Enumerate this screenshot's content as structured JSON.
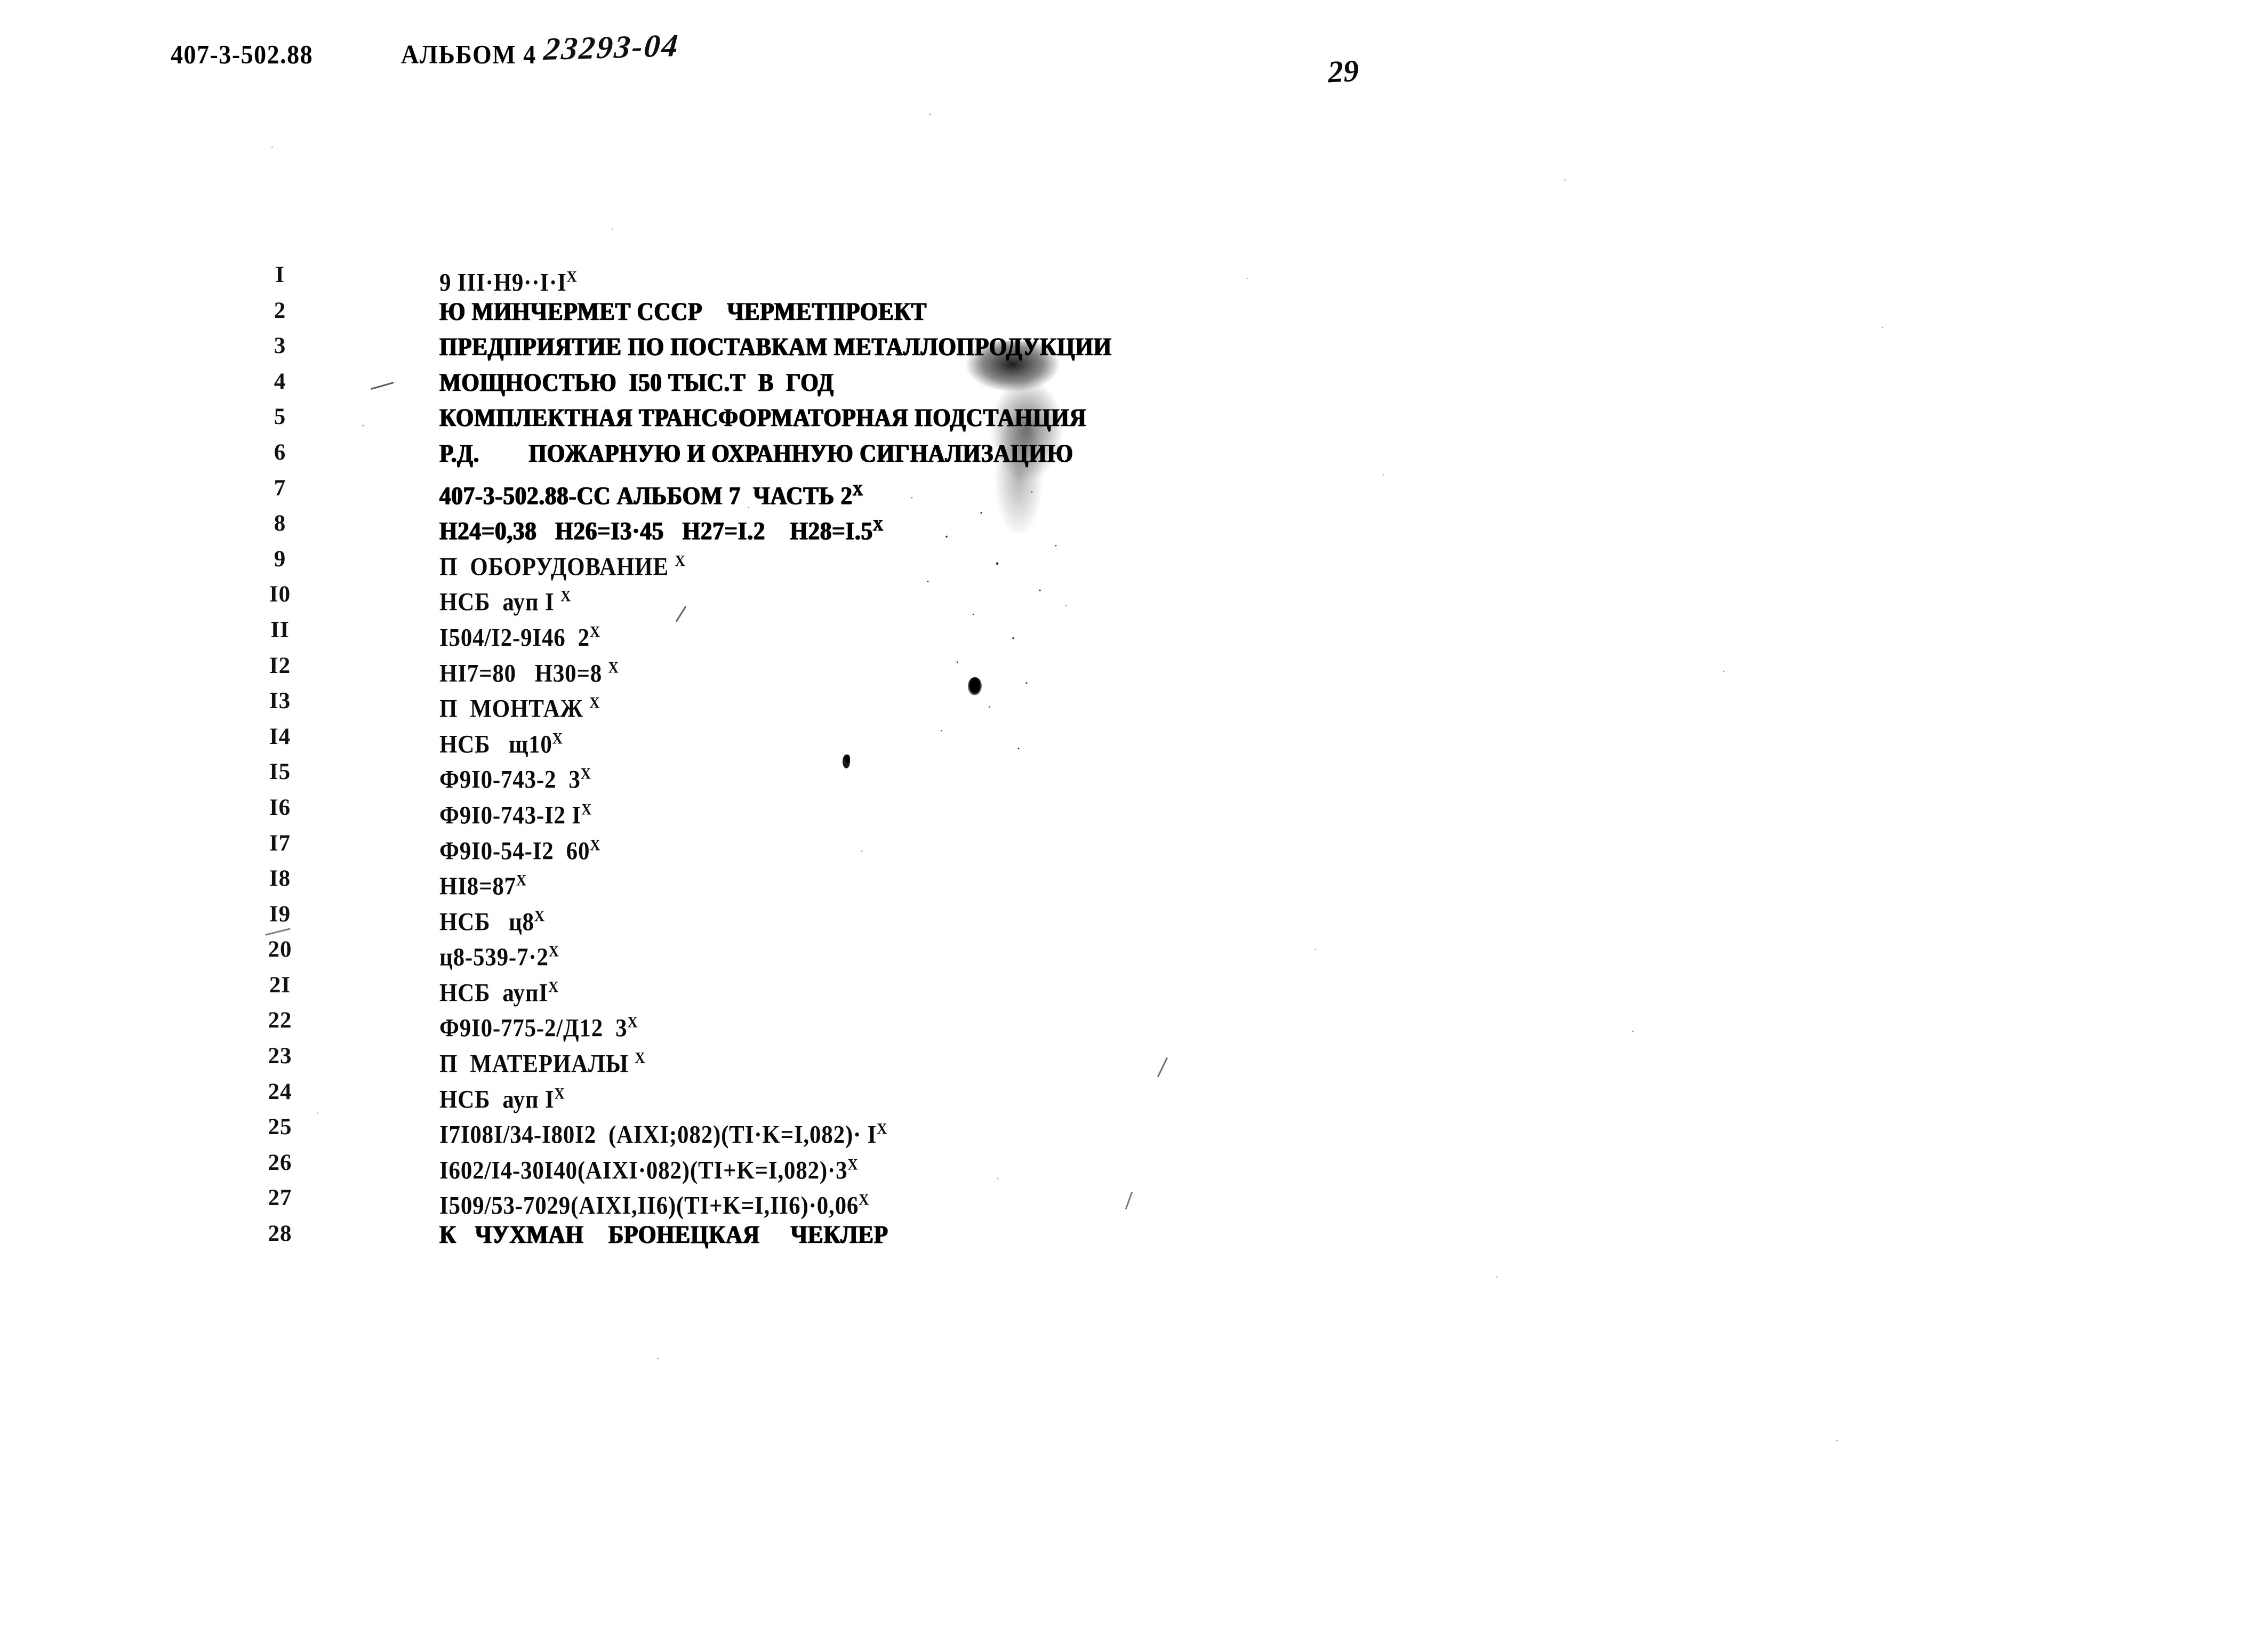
{
  "header": {
    "doc_code": "407-3-502.88",
    "album_label": "АЛЬБОМ 4",
    "order_number": "23293-04",
    "page_number": "29"
  },
  "listing": {
    "rows": [
      {
        "num": "I",
        "text": "9 III·H9··I·I",
        "sup": "X",
        "heavy": false
      },
      {
        "num": "2",
        "text": "Ю МИНЧЕРМЕТ СССР    ЧЕРМЕТПРОЕКТ",
        "sup": "",
        "heavy": true
      },
      {
        "num": "3",
        "text": "ПРЕДПРИЯТИЕ ПО ПОСТАВКАМ МЕТАЛЛОПРОДУКЦИИ",
        "sup": "",
        "heavy": true
      },
      {
        "num": "4",
        "text": "МОЩНОСТЬЮ  I50 ТЫС.Т  В  ГОД",
        "sup": "",
        "heavy": true
      },
      {
        "num": "5",
        "text": "КОМПЛЕКТНАЯ ТРАНСФОРМАТОРНАЯ ПОДСТАНЦИЯ",
        "sup": "",
        "heavy": true
      },
      {
        "num": "6",
        "text": "Р.Д.        ПОЖАРНУЮ И ОХРАННУЮ СИГНАЛИЗАЦИЮ",
        "sup": "",
        "heavy": true
      },
      {
        "num": "7",
        "text": "407-3-502.88-СС АЛЬБОМ 7  ЧАСТЬ 2",
        "sup": "X",
        "heavy": true
      },
      {
        "num": "8",
        "text": "H24=0,38   H26=I3·45   H27=I.2    H28=I.5",
        "sup": "X",
        "heavy": true
      },
      {
        "num": "9",
        "text": "П  ОБОРУДОВАНИЕ ",
        "sup": "X",
        "heavy": false
      },
      {
        "num": "I0",
        "text": "НСБ  ауп I ",
        "sup": "X",
        "heavy": false
      },
      {
        "num": "II",
        "text": "I504/I2-9I46  2",
        "sup": "X",
        "heavy": false
      },
      {
        "num": "I2",
        "text": "HI7=80   H30=8 ",
        "sup": "X",
        "heavy": false
      },
      {
        "num": "I3",
        "text": "П  МОНТАЖ ",
        "sup": "X",
        "heavy": false
      },
      {
        "num": "I4",
        "text": "НСБ   щ10",
        "sup": "X",
        "heavy": false
      },
      {
        "num": "I5",
        "text": "Ф9I0-743-2  3",
        "sup": "X",
        "heavy": false
      },
      {
        "num": "I6",
        "text": "Ф9I0-743-I2 I",
        "sup": "X",
        "heavy": false
      },
      {
        "num": "I7",
        "text": "Ф9I0-54-I2  60",
        "sup": "X",
        "heavy": false
      },
      {
        "num": "I8",
        "text": "HI8=87",
        "sup": "X",
        "heavy": false
      },
      {
        "num": "I9",
        "text": "НСБ   ц8",
        "sup": "X",
        "heavy": false
      },
      {
        "num": "20",
        "text": "ц8-539-7·2",
        "sup": "X",
        "heavy": false
      },
      {
        "num": "2I",
        "text": "НСБ  аупI",
        "sup": "X",
        "heavy": false
      },
      {
        "num": "22",
        "text": "Ф9I0-775-2/Д12  3",
        "sup": "X",
        "heavy": false
      },
      {
        "num": "23",
        "text": "П  МАТЕРИАЛЫ ",
        "sup": "X",
        "heavy": false
      },
      {
        "num": "24",
        "text": "НСБ  ауп I",
        "sup": "X",
        "heavy": false
      },
      {
        "num": "25",
        "text": "I7I08I/34-I80I2  (AIXI;082)(TI·K=I,082)· I",
        "sup": "X",
        "heavy": false
      },
      {
        "num": "26",
        "text": "I602/I4-30I40(AIXI·082)(TI+K=I,082)·3",
        "sup": "X",
        "heavy": false
      },
      {
        "num": "27",
        "text": "I509/53-7029(AIXI,II6)(TI+K=I,II6)·0,06",
        "sup": "X",
        "heavy": false
      },
      {
        "num": "28",
        "text": "К   ЧУХМАН    БРОНЕЦКАЯ     ЧЕКЛЕР",
        "sup": "",
        "heavy": true
      }
    ]
  }
}
